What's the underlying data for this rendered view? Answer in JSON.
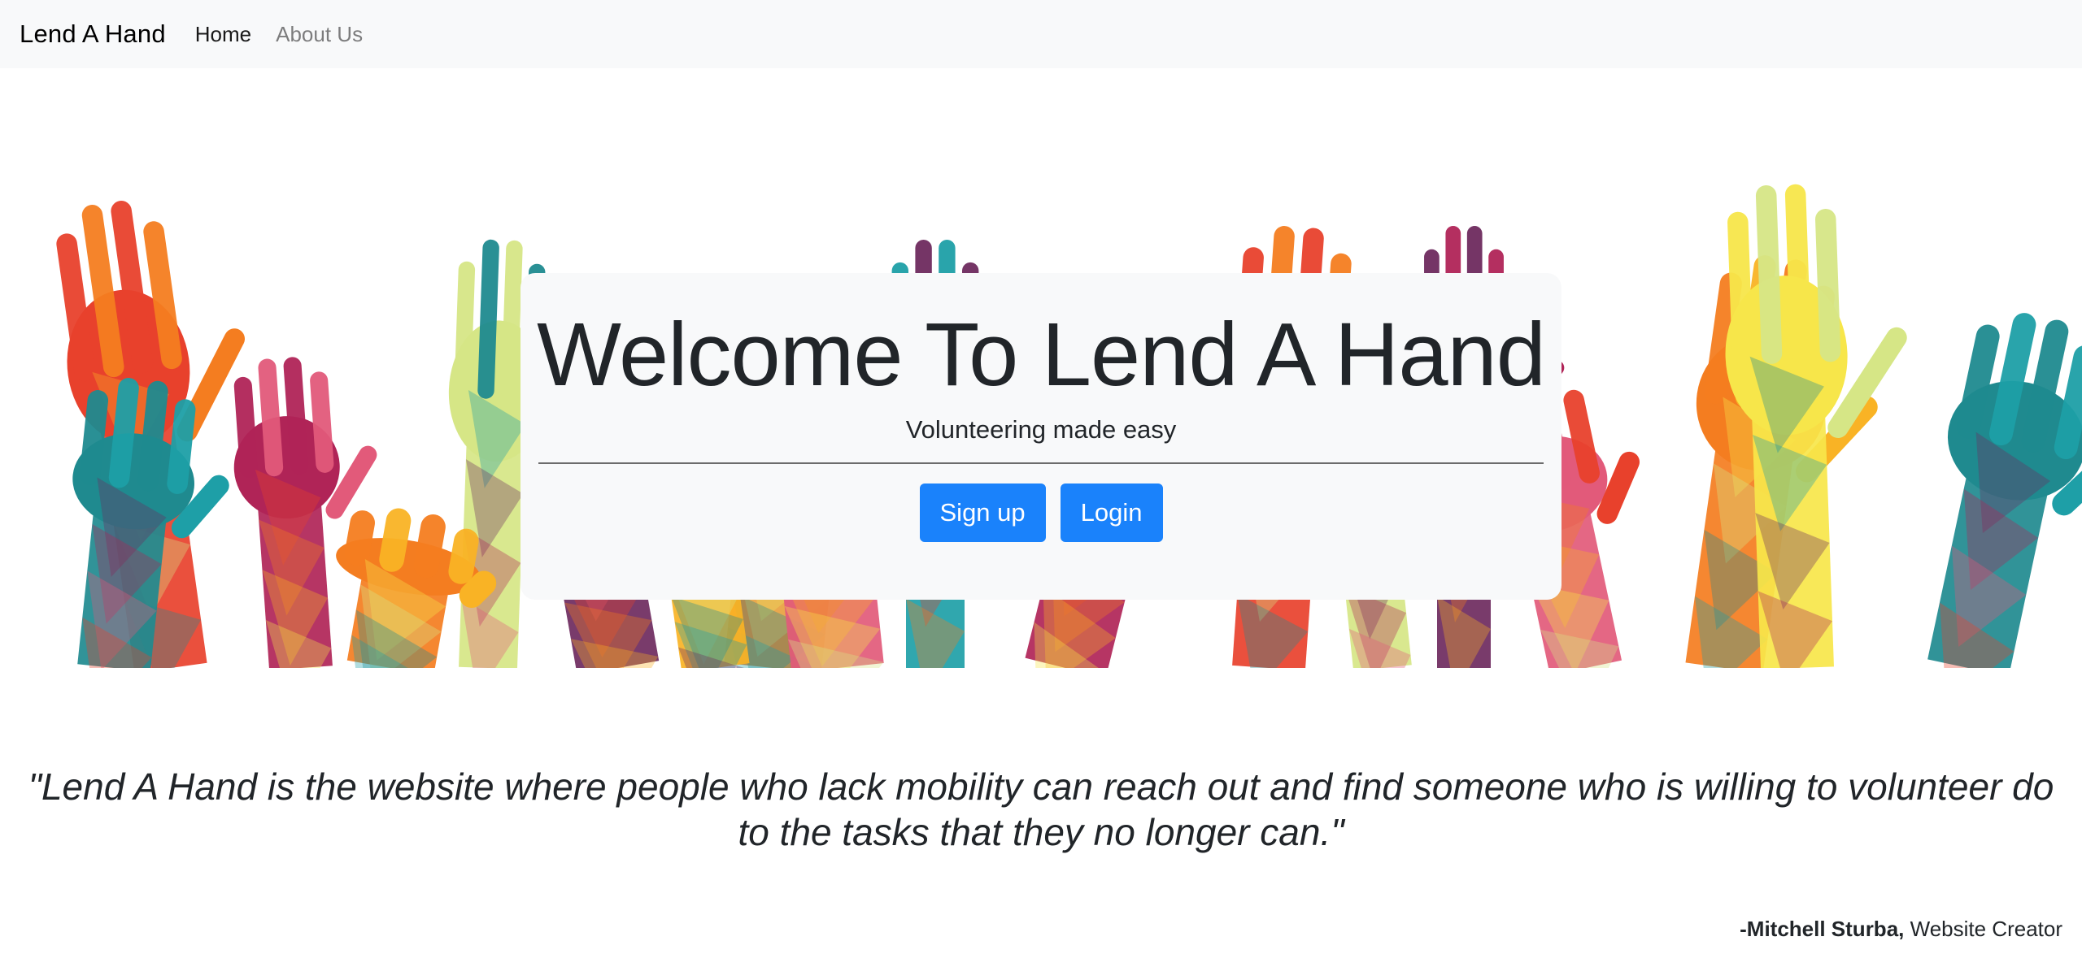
{
  "navbar": {
    "brand": "Lend A Hand",
    "links": [
      {
        "label": "Home",
        "active": true
      },
      {
        "label": "About Us",
        "active": false
      }
    ]
  },
  "hero": {
    "title": "Welcome To Lend A Hand",
    "subtitle": "Volunteering made easy",
    "signup_label": "Sign up",
    "login_label": "Login",
    "image_icon": "raised-hands-illustration",
    "palette": [
      "#e8412c",
      "#f47d20",
      "#f9b325",
      "#f7e64a",
      "#d6e686",
      "#1f8a8f",
      "#1e9fa7",
      "#6e2a5e",
      "#b02457",
      "#e25a7a"
    ]
  },
  "quote": {
    "text": "\"Lend A Hand is the website where people who lack mobility can reach out and find someone who is willing to volunteer do to the tasks that they no longer can.\"",
    "author": "-Mitchell Sturba,",
    "role": "Website Creator"
  },
  "colors": {
    "navbar_bg": "#f8f9fa",
    "button_primary": "#1a82fb",
    "jumbotron_bg": "#f8f9fa"
  }
}
